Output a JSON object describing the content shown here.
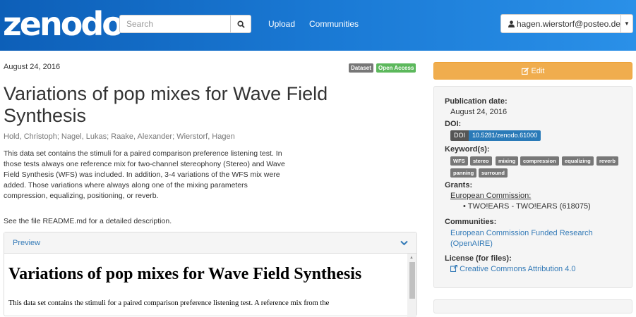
{
  "header": {
    "logo": "zenodo",
    "search_placeholder": "Search",
    "nav": [
      "Upload",
      "Communities"
    ],
    "user": "hagen.wierstorf@posteo.de"
  },
  "record": {
    "date": "August 24, 2016",
    "badges": [
      {
        "label": "Dataset",
        "color": "#777777"
      },
      {
        "label": "Open Access",
        "color": "#5cb85c"
      }
    ],
    "title": "Variations of pop mixes for Wave Field Synthesis",
    "authors": "Hold, Christoph; Nagel, Lukas; Raake, Alexander; Wierstorf, Hagen",
    "description": "This data set contains the stimuli for a paired comparison preference listening test. In those tests always one reference mix for two-channel stereophony (Stereo) and Wave Field Synthesis (WFS) was included. In addition, 3-4 variations of the WFS mix were added. Those variations where always along one of the mixing parameters compression, equalizing, positioning, or reverb.",
    "readme_note": "See the file README.md for a detailed description."
  },
  "preview": {
    "label": "Preview",
    "heading": "Variations of pop mixes for Wave Field Synthesis",
    "text": "This data set contains the stimuli for a paired comparison preference listening test. A reference mix from the"
  },
  "sidebar": {
    "edit_label": "Edit",
    "publication_date_label": "Publication date:",
    "publication_date": "August 24, 2016",
    "doi_label": "DOI:",
    "doi_prefix": "DOI",
    "doi": "10.5281/zenodo.61000",
    "keywords_label": "Keyword(s):",
    "keywords": [
      "WFS",
      "stereo",
      "mixing",
      "compression",
      "equalizing",
      "reverb",
      "panning",
      "surround"
    ],
    "grants_label": "Grants:",
    "grant_funder": "European Commission:",
    "grant_item": "TWO!EARS - TWO!EARS (618075)",
    "communities_label": "Communities:",
    "community": "European Commission Funded Research (OpenAIRE)",
    "license_label": "License (for files):",
    "license": "Creative Commons Attribution 4.0"
  }
}
